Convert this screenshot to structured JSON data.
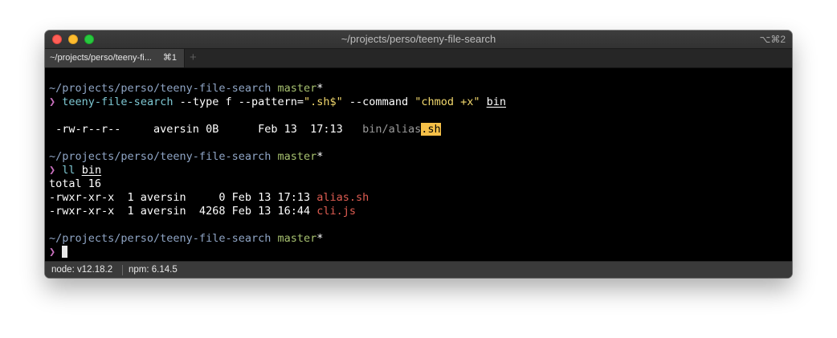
{
  "window": {
    "title": "~/projects/perso/teeny-file-search",
    "shortcut": "⌥⌘2"
  },
  "tab": {
    "label": "~/projects/perso/teeny-fi...",
    "shortcut": "⌘1",
    "add_icon": "+"
  },
  "prompt": {
    "path": "~/projects/perso/teeny-file-search",
    "branch": "master",
    "dirty_marker": "*",
    "arrow": "❯"
  },
  "command1": {
    "program": "teeny-file-search",
    "opt1": " --type f --pattern=",
    "pattern": "\".sh$\"",
    "opt2": " --command ",
    "command_value": "\"chmod +x\"",
    "dir": "bin"
  },
  "result1": {
    "perms": " -rw-r--r--",
    "owner_size_date": "     aversin 0B      Feb 13  17:13   ",
    "path_prefix": "bin/alias",
    "path_match": ".sh"
  },
  "command2": {
    "program": "ll",
    "dir": "bin"
  },
  "listing": {
    "total": "total 16",
    "rows": [
      {
        "meta": "-rwxr-xr-x  1 aversin     0 Feb 13 17:13 ",
        "name": "alias.sh"
      },
      {
        "meta": "-rwxr-xr-x  1 aversin  4268 Feb 13 16:44 ",
        "name": "cli.js"
      }
    ]
  },
  "status": {
    "node": "node: v12.18.2",
    "npm": "npm: 6.14.5"
  },
  "colors": {
    "path": "#8fa5c5",
    "branch": "#a6c06f",
    "arrow": "#c970be",
    "command": "#7ec8d3",
    "string": "#f2d86d",
    "executable": "#df5d52",
    "match_highlight": "#f6c048"
  }
}
